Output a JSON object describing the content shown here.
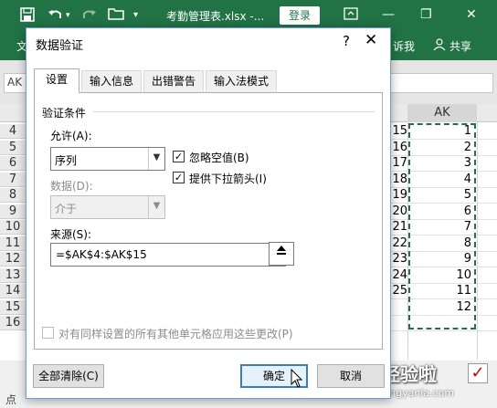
{
  "excel": {
    "file_title": "考勤管理表.xlsx  -...",
    "login_label": "登录",
    "ribbon_left": "文",
    "ribbon_tell": "诉我",
    "ribbon_share": "共享",
    "name_box": "AK",
    "column_header": "AK",
    "row_numbers": [
      "4",
      "5",
      "6",
      "7",
      "8",
      "9",
      "10",
      "11",
      "12",
      "13",
      "14",
      "15",
      "16"
    ],
    "column_left_values": [
      "15",
      "16",
      "17",
      "18",
      "19",
      "20",
      "21",
      "22",
      "23",
      "24",
      "25",
      "",
      ""
    ],
    "column_ak_values": [
      "1",
      "2",
      "3",
      "4",
      "5",
      "6",
      "7",
      "8",
      "9",
      "10",
      "11",
      "12",
      ""
    ],
    "status_text": "点",
    "watermark_text": "经验啦",
    "watermark_url": "jingyanla.com"
  },
  "dialog": {
    "title": "数据验证",
    "help": "?",
    "close": "✕",
    "tabs": [
      "设置",
      "输入信息",
      "出错警告",
      "输入法模式"
    ],
    "group_title": "验证条件",
    "allow_label": "允许(A):",
    "allow_value": "序列",
    "data_label": "数据(D):",
    "data_value": "介于",
    "ignore_blank_label": "忽略空值(B)",
    "ignore_blank_checked": true,
    "dropdown_label": "提供下拉箭头(I)",
    "dropdown_checked": true,
    "source_label": "来源(S):",
    "source_value": "=$AK$4:$AK$15",
    "apply_all_label": "对有同样设置的所有其他单元格应用这些更改(P)",
    "apply_all_checked": false,
    "clear_all_button": "全部清除(C)",
    "ok_button": "确定",
    "cancel_button": "取消"
  },
  "colors": {
    "excel_green": "#217346",
    "dialog_border": "#6a9fd6",
    "default_button_border": "#3c7fb1"
  }
}
